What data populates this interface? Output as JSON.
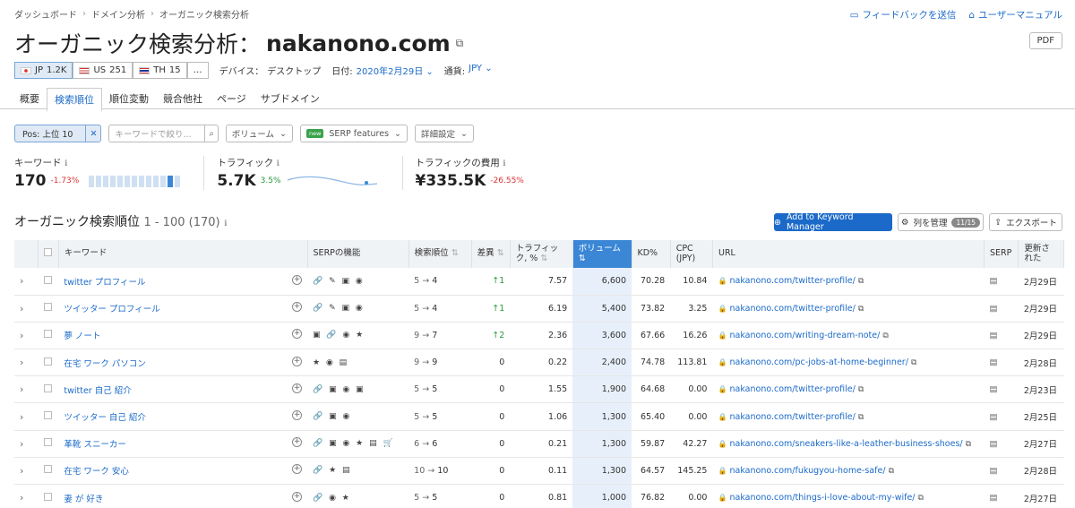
{
  "breadcrumb": [
    "ダッシュボード",
    "ドメイン分析",
    "オーガニック検索分析"
  ],
  "top_links": {
    "feedback": "フィードバックを送信",
    "manual": "ユーザーマニュアル"
  },
  "title": {
    "prefix": "オーガニック検索分析：",
    "domain": "nakanono.com"
  },
  "pdf_label": "PDF",
  "databases": [
    {
      "flag": "jp",
      "code": "JP",
      "count": "1.2K"
    },
    {
      "flag": "us",
      "code": "US",
      "count": "251"
    },
    {
      "flag": "th",
      "code": "TH",
      "count": "15"
    }
  ],
  "more_label": "…",
  "meta": {
    "device_label": "デバイス：",
    "device": "デスクトップ",
    "date_label": "日付:",
    "date": "2020年2月29日",
    "currency_label": "通貨:",
    "currency": "JPY"
  },
  "tabs": [
    "概要",
    "検索順位",
    "順位変動",
    "競合他社",
    "ページ",
    "サブドメイン"
  ],
  "filters": {
    "pos": "Pos: 上位 10",
    "search_placeholder": "キーワードで絞り...",
    "volume": "ボリューム",
    "new": "new",
    "serp": "SERP features",
    "advanced": "詳細設定"
  },
  "stats": [
    {
      "label": "キーワード",
      "value": "170",
      "change": "-1.73%",
      "trend": "neg"
    },
    {
      "label": "トラフィック",
      "value": "5.7K",
      "change": "3.5%",
      "trend": "pos"
    },
    {
      "label": "トラフィックの費用",
      "value": "¥335.5K",
      "change": "-26.55%",
      "trend": "neg"
    }
  ],
  "section": {
    "title": "オーガニック検索順位",
    "sub": "1 - 100 (170)"
  },
  "buttons": {
    "akm": "Add to Keyword Manager",
    "columns": "列を管理",
    "columns_badge": "11/15",
    "export": "エクスポート"
  },
  "columns": [
    "キーワード",
    "SERPの機能",
    "検索順位",
    "差異",
    "トラフィック, %",
    "ボリューム",
    "KD%",
    "CPC (JPY)",
    "URL",
    "SERP",
    "更新された"
  ],
  "rows": [
    {
      "kw": "twitter プロフィール",
      "serp": "🔗 ✎ ▣ ◉",
      "from": "5",
      "to": "4",
      "diff": "↑1",
      "traffic": "7.57",
      "vol": "6,600",
      "kd": "70.28",
      "cpc": "10.84",
      "url": "nakanono.com/twitter-profile/",
      "upd": "2月29日"
    },
    {
      "kw": "ツイッター プロフィール",
      "serp": "🔗 ✎ ▣ ◉",
      "from": "5",
      "to": "4",
      "diff": "↑1",
      "traffic": "6.19",
      "vol": "5,400",
      "kd": "73.82",
      "cpc": "3.25",
      "url": "nakanono.com/twitter-profile/",
      "upd": "2月29日"
    },
    {
      "kw": "夢 ノート",
      "serp": "▣ 🔗 ◉ ★",
      "from": "9",
      "to": "7",
      "diff": "↑2",
      "traffic": "2.36",
      "vol": "3,600",
      "kd": "67.66",
      "cpc": "16.26",
      "url": "nakanono.com/writing-dream-note/",
      "upd": "2月29日"
    },
    {
      "kw": "在宅 ワーク パソコン",
      "serp": "★ ◉ ▤",
      "from": "9",
      "to": "9",
      "diff": "0",
      "traffic": "0.22",
      "vol": "2,400",
      "kd": "74.78",
      "cpc": "113.81",
      "url": "nakanono.com/pc-jobs-at-home-beginner/",
      "upd": "2月28日"
    },
    {
      "kw": "twitter 自己 紹介",
      "serp": "🔗 ▣ ◉ ▣",
      "from": "5",
      "to": "5",
      "diff": "0",
      "traffic": "1.55",
      "vol": "1,900",
      "kd": "64.68",
      "cpc": "0.00",
      "url": "nakanono.com/twitter-profile/",
      "upd": "2月23日"
    },
    {
      "kw": "ツイッター 自己 紹介",
      "serp": "🔗 ▣ ◉",
      "from": "5",
      "to": "5",
      "diff": "0",
      "traffic": "1.06",
      "vol": "1,300",
      "kd": "65.40",
      "cpc": "0.00",
      "url": "nakanono.com/twitter-profile/",
      "upd": "2月25日"
    },
    {
      "kw": "革靴 スニーカー",
      "serp": "🔗 ▣ ◉ ★ ▤ 🛒",
      "from": "6",
      "to": "6",
      "diff": "0",
      "traffic": "0.21",
      "vol": "1,300",
      "kd": "59.87",
      "cpc": "42.27",
      "url": "nakanono.com/sneakers-like-a-leather-business-shoes/",
      "upd": "2月27日"
    },
    {
      "kw": "在宅 ワーク 安心",
      "serp": "🔗 ★ ▤",
      "from": "10",
      "to": "10",
      "diff": "0",
      "traffic": "0.11",
      "vol": "1,300",
      "kd": "64.57",
      "cpc": "145.25",
      "url": "nakanono.com/fukugyou-home-safe/",
      "upd": "2月28日"
    },
    {
      "kw": "妻 が 好き",
      "serp": "🔗 ◉ ★",
      "from": "5",
      "to": "5",
      "diff": "0",
      "traffic": "0.81",
      "vol": "1,000",
      "kd": "76.82",
      "cpc": "0.00",
      "url": "nakanono.com/things-i-love-about-my-wife/",
      "upd": "2月27日"
    }
  ]
}
